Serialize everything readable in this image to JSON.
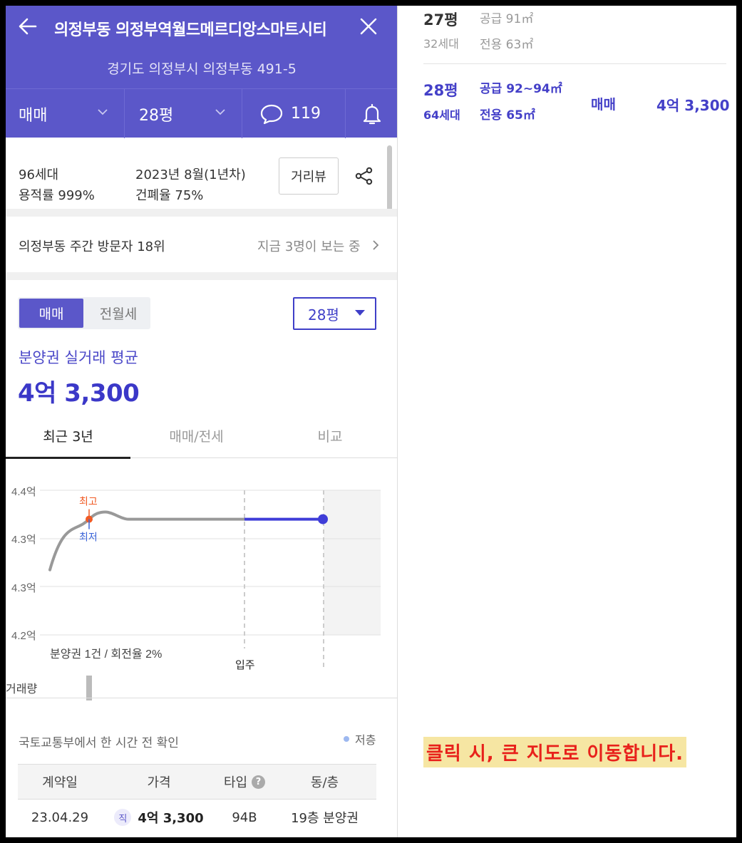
{
  "header": {
    "title": "의정부동 의정부역월드메르디앙스마트시티",
    "address": "경기도 의정부시 의정부동 491-5",
    "filter_trade": "매매",
    "filter_size": "28평",
    "comment_count": "119"
  },
  "info": {
    "households": "96세대",
    "floor_area_ratio": "용적률 999%",
    "completion": "2023년 8월(1년차)",
    "coverage_ratio": "건폐율 75%",
    "street_view_label": "거리뷰"
  },
  "visitors": {
    "rank_text": "의정부동 주간 방문자 18위",
    "viewing_text": "지금 3명이 보는 중"
  },
  "price_panel": {
    "toggle_sale": "매매",
    "toggle_rent": "전월세",
    "size_select": "28평",
    "avg_label": "분양권 실거래 평균",
    "avg_value": "4억 3,300"
  },
  "tabs": [
    "최근 3년",
    "매매/전세",
    "비교"
  ],
  "chart_data": {
    "type": "line",
    "y_tick_labels": [
      "4.4억",
      "4.3억",
      "4.3억",
      "4.2억"
    ],
    "ylim": [
      4.2,
      4.4
    ],
    "series": [
      {
        "style": "history",
        "color": "#999999",
        "values": [
          4.29,
          4.36,
          4.37,
          4.36,
          4.36,
          4.36
        ]
      },
      {
        "style": "recent",
        "color": "#3f3dd8",
        "values": [
          4.36,
          4.36
        ]
      }
    ],
    "markers": {
      "high_label": "최고",
      "low_label": "최저",
      "high_color": "#f05a24",
      "low_color": "#3b64d8"
    },
    "event_label": "입주",
    "volume_label": "거래량",
    "volume_note": "분양권 1건 / 회전율 2%",
    "grid": true
  },
  "source": {
    "text": "국토교통부에서 한 시간 전 확인",
    "legend": "저층"
  },
  "table": {
    "headers": [
      "계약일",
      "가격",
      "타입",
      "동/층"
    ],
    "rows": [
      {
        "date": "23.04.29",
        "badge": "직",
        "price": "4억 3,300",
        "type": "94B",
        "floor": "19층 분양권"
      }
    ]
  },
  "right_panel": {
    "row1": {
      "size": "27평",
      "supply": "공급 91㎡",
      "households": "32세대",
      "exclusive": "전용 63㎡"
    },
    "row2": {
      "size": "28평",
      "supply": "공급 92~94㎡",
      "households": "64세대",
      "exclusive": "전용 65㎡",
      "trade_type": "매매",
      "price": "4억 3,300"
    },
    "notice": "클릭 시, 큰 지도로 이동합니다."
  },
  "colors": {
    "brand": "#5b57c9",
    "accent": "#3b38c8",
    "notice_red": "#e8211b",
    "notice_bg": "#f6e6a3"
  }
}
